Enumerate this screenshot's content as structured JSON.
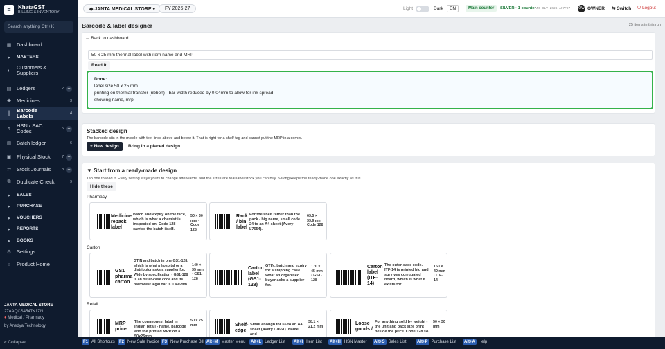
{
  "brand": {
    "name": "KhataGST",
    "sub": "BILLING & INVENTORY",
    "logo": "≡"
  },
  "search": {
    "placeholder": "Search anything",
    "shortcut": "Ctrl+K"
  },
  "nav": [
    {
      "label": "Dashboard",
      "icon": "▦",
      "count": "",
      "plus": false,
      "active": false,
      "section": false
    },
    {
      "label": "MASTERS",
      "icon": "▸",
      "count": "",
      "plus": false,
      "active": false,
      "section": true
    },
    {
      "label": "Customers & Suppliers",
      "icon": "◐",
      "count": "1",
      "plus": false,
      "active": false,
      "section": false
    },
    {
      "label": "Ledgers",
      "icon": "▤",
      "count": "2",
      "plus": true,
      "active": false,
      "section": false
    },
    {
      "label": "Medicines",
      "icon": "✚",
      "count": "3",
      "plus": false,
      "active": false,
      "section": false
    },
    {
      "label": "Barcode Labels",
      "icon": "║",
      "count": "4",
      "plus": false,
      "active": true,
      "section": false
    },
    {
      "label": "HSN / SAC Codes",
      "icon": "#",
      "count": "5",
      "plus": true,
      "active": false,
      "section": false
    },
    {
      "label": "Batch ledger",
      "icon": "▥",
      "count": "6",
      "plus": false,
      "active": false,
      "section": false
    },
    {
      "label": "Physical Stock",
      "icon": "▣",
      "count": "7",
      "plus": true,
      "active": false,
      "section": false
    },
    {
      "label": "Stock Journals",
      "icon": "⇄",
      "count": "8",
      "plus": true,
      "active": false,
      "section": false
    },
    {
      "label": "Duplicate Check",
      "icon": "⧉",
      "count": "9",
      "plus": false,
      "active": false,
      "section": false
    },
    {
      "label": "SALES",
      "icon": "▸",
      "count": "",
      "plus": false,
      "active": false,
      "section": true
    },
    {
      "label": "PURCHASE",
      "icon": "▸",
      "count": "",
      "plus": false,
      "active": false,
      "section": true
    },
    {
      "label": "VOUCHERS",
      "icon": "▸",
      "count": "",
      "plus": false,
      "active": false,
      "section": true
    },
    {
      "label": "REPORTS",
      "icon": "▸",
      "count": "",
      "plus": false,
      "active": false,
      "section": true
    },
    {
      "label": "BOOKS",
      "icon": "▸",
      "count": "",
      "plus": false,
      "active": false,
      "section": true
    },
    {
      "label": "Settings",
      "icon": "⚙",
      "count": "",
      "plus": false,
      "active": false,
      "section": false
    },
    {
      "label": "Product Home",
      "icon": "⌂",
      "count": "",
      "plus": false,
      "active": false,
      "section": false
    }
  ],
  "company": {
    "name": "JANTA MEDICAL STORE",
    "gstin": "27AAQCS4547K1ZN",
    "type": "Medical / Pharmacy",
    "by": "by Anedya Technology",
    "collapse": "« Collapse"
  },
  "topbar": {
    "company": "JANTA MEDICAL STORE",
    "fy": "FY 2026-27",
    "light": "Light",
    "dark": "Dark",
    "lang": "EN",
    "counter": "Main counter",
    "plan": "SILVER · 1 counter",
    "plan_code": "ANO-SLV-2026-A07F97",
    "avatar": "OW",
    "role": "OWNER",
    "switch": "⇆ Switch",
    "logout": "⏻ Logout"
  },
  "page": {
    "title": "Barcode & label designer",
    "meta": "25 items in this run",
    "back": "← Back to dashboard"
  },
  "request": {
    "input": "50 x 25 mm thermal label with item name and MRP",
    "read": "Read it",
    "done_title": "Done:",
    "done_lines": [
      "label size 50 x 25 mm",
      "printing on thermal transfer (ribbon) - bar width reduced by 0.04mm to allow for ink spread",
      "showing name, mrp"
    ]
  },
  "stacked": {
    "title": "Stacked design",
    "desc": "The barcode sits in the middle with text lines above and below it. That is right for a shelf tag and cannot put the MRP in a corner.",
    "new_btn": "+ New design",
    "placed_btn": "Bring in a placed design…"
  },
  "ready": {
    "title": "▼ Start from a ready-made design",
    "desc": "Tap one to load it. Every setting stays yours to change afterwards, and the sizes are real label stock you can buy. Saving keeps the ready-made one exactly as it is.",
    "hide": "Hide these",
    "cat_pharmacy": "Pharmacy",
    "cat_carton": "Carton",
    "cat_retail": "Retail",
    "tiles": [
      {
        "name": "Medicine repack label",
        "desc": "Batch and expiry on the face, which is what a chemist is inspected on. Code 128 carries the batch itself.",
        "size": "50 × 30 mm · Code 128"
      },
      {
        "name": "Rack / bin label",
        "desc": "For the shelf rather than the pack - big name, small code. 24 to an A4 sheet (Avery L7654).",
        "size": "63.5 × 33.9 mm · Code 128"
      },
      {
        "name": "GS1 pharma carton",
        "desc": "GTIN and batch in one GS1-128, which is what a hospital or a distributor asks a supplier for. Wide by specification - GS1-128 is an outer-case code and its narrowest legal bar is 0.495mm.",
        "size": "140 × 35 mm · GS1-128"
      },
      {
        "name": "Carton label (GS1-128)",
        "desc": "GTIN, batch and expiry for a shipping case. What an organised buyer asks a supplier for.",
        "size": "170 × 45 mm · GS1-128"
      },
      {
        "name": "Carton label (ITF-14)",
        "desc": "The outer-case code. ITF-14 is printed big and survives corrugated board, which is what it exists for.",
        "size": "150 × 40 mm · ITF-14"
      },
      {
        "name": "MRP price",
        "desc": "The commonest label in Indian retail - name, barcode and the printed MRP on a 50x25mm",
        "size": "50 × 25 mm"
      },
      {
        "name": "Shelf-edge",
        "desc": "Small enough for 65 to an A4 sheet (Avery L7651). Name and",
        "size": "38.1 × 21.2 mm"
      },
      {
        "name": "Loose goods /",
        "desc": "For anything sold by weight - the unit and pack size print beside the price. Code 128 so",
        "size": "50 × 30 mm"
      }
    ]
  },
  "footer": [
    {
      "key": "F1",
      "label": "All Shortcuts"
    },
    {
      "key": "F2",
      "label": "New Sale Invoice"
    },
    {
      "key": "F3",
      "label": "New Purchase Bill"
    },
    {
      "key": "Alt+M",
      "label": "Master Menu"
    },
    {
      "key": "Alt+L",
      "label": "Ledger List"
    },
    {
      "key": "Alt+I",
      "label": "Item List"
    },
    {
      "key": "Alt+H",
      "label": "HSN Master"
    },
    {
      "key": "Alt+S",
      "label": "Sales List"
    },
    {
      "key": "Alt+P",
      "label": "Purchase List"
    },
    {
      "key": "Alt+A",
      "label": "Help"
    }
  ]
}
